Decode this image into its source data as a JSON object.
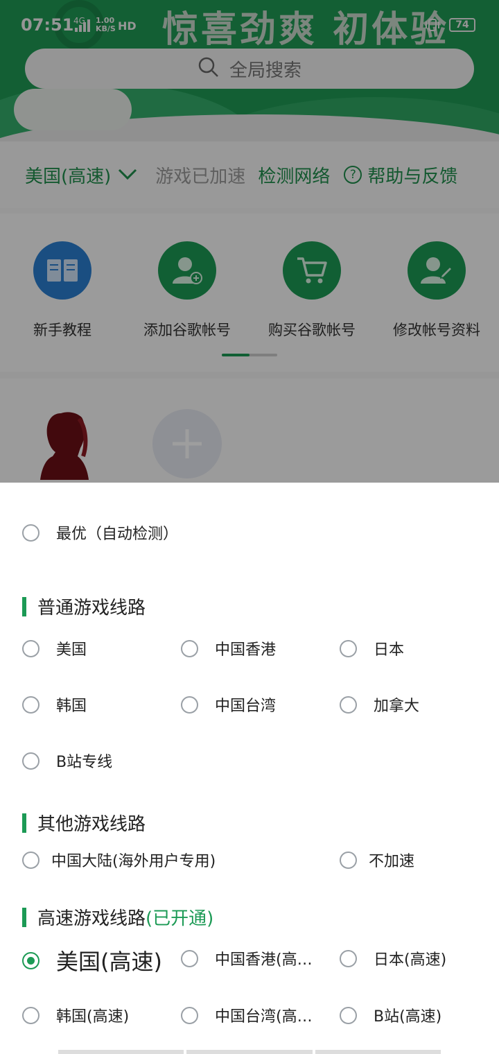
{
  "status_bar": {
    "time": "07:51",
    "network": "4G",
    "speed_value": "1.00",
    "speed_unit": "KB/S",
    "hd": "HD",
    "battery": "74"
  },
  "banner": {
    "title": "惊喜劲爽 初体验"
  },
  "search": {
    "placeholder": "全局搜索"
  },
  "nav": {
    "route": "美国(高速)",
    "status": "游戏已加速",
    "detect": "检测网络",
    "help": "帮助与反馈"
  },
  "quick_actions": [
    {
      "label": "新手教程",
      "icon": "book-icon"
    },
    {
      "label": "添加谷歌帐号",
      "icon": "add-user-icon"
    },
    {
      "label": "购买谷歌帐号",
      "icon": "cart-icon"
    },
    {
      "label": "修改帐号资料",
      "icon": "edit-user-icon"
    }
  ],
  "sheet": {
    "auto_option": "最优（自动检测）",
    "sections": [
      {
        "title": "普通游戏线路",
        "accent": ""
      },
      {
        "title": "其他游戏线路",
        "accent": ""
      },
      {
        "title": "高速游戏线路",
        "accent": "(已开通)"
      }
    ],
    "normal_routes": [
      "美国",
      "中国香港",
      "日本",
      "韩国",
      "中国台湾",
      "加拿大",
      "B站专线"
    ],
    "other_routes": [
      "中国大陆(海外用户专用)",
      "不加速"
    ],
    "fast_routes": [
      "美国(高速)",
      "中国香港(高速)",
      "日本(高速)",
      "韩国(高速)",
      "中国台湾(高速)",
      "B站(高速)"
    ],
    "selected": "美国(高速)"
  },
  "colors": {
    "brand_green": "#1c9a55",
    "info_blue": "#2a7fd0"
  }
}
